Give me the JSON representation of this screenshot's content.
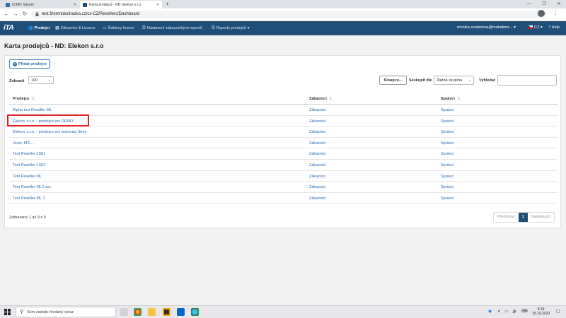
{
  "browser": {
    "tabs": [
      {
        "label": "ISTAV Xplorer"
      },
      {
        "label": "Karta prodejců - ND: Elekon s.r.o."
      }
    ],
    "url": "test.firemnidochazka.cz/cs-CZ/Resellers/Dashboard"
  },
  "app": {
    "logo": "iTA",
    "nav": [
      {
        "label": "Prodejci",
        "icon": "users-icon"
      },
      {
        "label": "Zákazníci & Licence",
        "icon": "building-icon"
      },
      {
        "label": "Šablony licencí",
        "icon": "template-icon"
      },
      {
        "label": "Nastavení zákaznických reportů",
        "icon": "print-icon"
      },
      {
        "label": "Reporty prodejců",
        "icon": "print-icon"
      }
    ],
    "user": "monika.svatonova@mobatime...",
    "language": "CZ",
    "help": "Help"
  },
  "page": {
    "title": "Karta prodejců - ND: Elekon s.r.o",
    "add_button": "Přidat prodejce",
    "show_label": "Zobrazit",
    "show_value": "100",
    "columns_button": "Sloupce...",
    "group_label": "Seskupit dle",
    "group_value": "Žádná skupina",
    "search_label": "Vyhledat",
    "search_value": "",
    "table": {
      "headers": [
        "Prodejce",
        "Zákazníci",
        "Správci"
      ],
      "rows": [
        {
          "name": "Alpha test Reseller ML",
          "customers": "Zákazníci",
          "admins": "Správci"
        },
        {
          "name": "Elekon, s.r.o. - prodejce pro DEMO",
          "customers": "Zákazníci",
          "admins": "Správci"
        },
        {
          "name": "Elekon, s.r.o. - prodejce pro testovací firmy",
          "customers": "Zákazníci",
          "admins": "Správci"
        },
        {
          "name": "Jesle, MŠ....",
          "customers": "Zákazníci",
          "admins": "Správci"
        },
        {
          "name": "Test Reseller LS01",
          "customers": "Zákazníci",
          "admins": "Správci"
        },
        {
          "name": "Test Reseller LS02",
          "customers": "Zákazníci",
          "admins": "Správci"
        },
        {
          "name": "Test Reseller ML",
          "customers": "Zákazníci",
          "admins": "Správci"
        },
        {
          "name": "Test Reseller ML2 xxx",
          "customers": "Zákazníci",
          "admins": "Správci"
        },
        {
          "name": "Test Reseller ML 1",
          "customers": "Zákazníci",
          "admins": "Správci"
        }
      ]
    },
    "info": "Zobrazeno 1 až 9 z 9",
    "pager": {
      "prev": "Předchozí",
      "current": "1",
      "next": "Následující"
    }
  },
  "taskbar": {
    "search_placeholder": "Sem zadejte hledaný výraz",
    "time": "9:19",
    "date": "15.10.2020"
  },
  "colors": {
    "navbar": "#1f4e79",
    "link": "#2a6db0",
    "highlight": "#e02020"
  }
}
